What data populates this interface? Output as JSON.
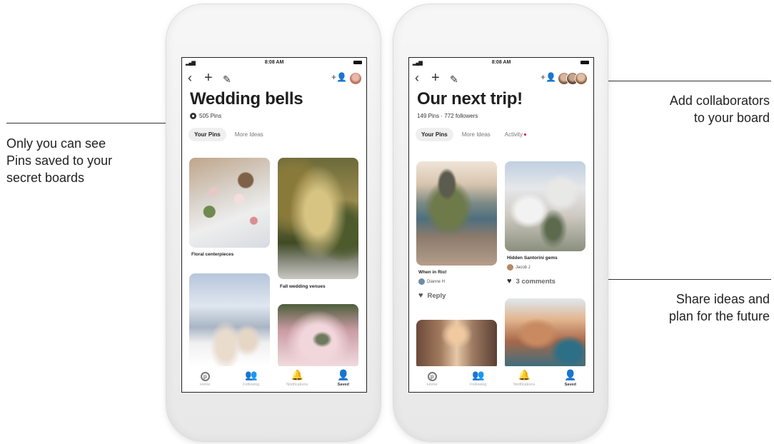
{
  "callouts": {
    "left": [
      "Only you can see",
      "Pins saved to your",
      "secret boards"
    ],
    "right_top": [
      "Add collaborators",
      "to your board"
    ],
    "right_bottom": [
      "Share ideas and",
      "plan for the future"
    ]
  },
  "phone1": {
    "status_time": "8:08 AM",
    "title": "Wedding bells",
    "meta": "505 Pins",
    "tabs": [
      "Your Pins",
      "More Ideas"
    ],
    "pins": [
      {
        "caption": "Floral centerpieces"
      },
      {
        "caption": "Fall wedding venues"
      }
    ]
  },
  "phone2": {
    "status_time": "8:08 AM",
    "title": "Our next trip!",
    "meta": "149 Pins · 772 followers",
    "tabs": [
      "Your Pins",
      "More Ideas",
      "Activity"
    ],
    "pins": [
      {
        "caption": "When in Rio!",
        "author": "Dianne H",
        "action": "Reply"
      },
      {
        "caption": "Hidden Santorini gems",
        "author": "Jacob J",
        "action": "3 comments"
      }
    ]
  },
  "nav": {
    "items": [
      {
        "label": "Home",
        "icon": "pinterest-icon"
      },
      {
        "label": "Following",
        "icon": "people-icon"
      },
      {
        "label": "Notifications",
        "icon": "bell-icon"
      },
      {
        "label": "Saved",
        "icon": "person-icon"
      }
    ]
  },
  "colors": {
    "accent_red": "#e60023",
    "text": "#222222"
  }
}
